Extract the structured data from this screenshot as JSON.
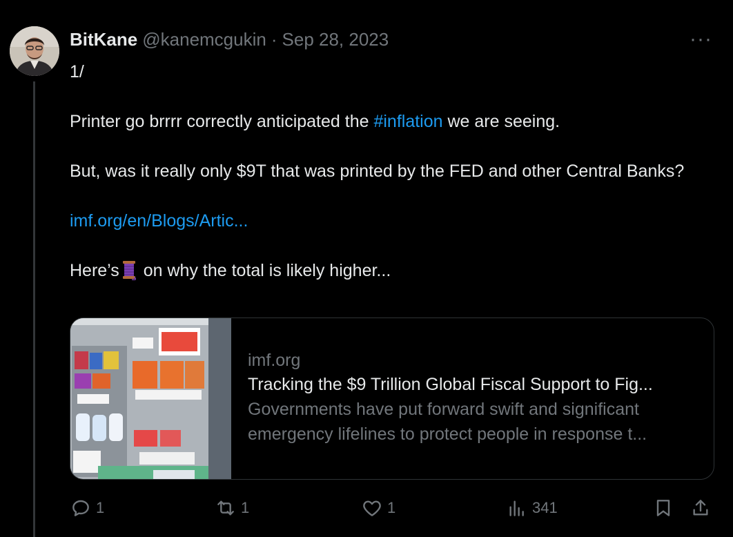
{
  "tweet": {
    "display_name": "BitKane",
    "handle": "@kanemcgukin",
    "separator": "·",
    "date": "Sep 28, 2023",
    "more_label": "···",
    "lines": {
      "l1": "1/",
      "l2_before": "Printer go brrrr correctly anticipated the ",
      "l2_hashtag": "#inflation",
      "l2_after": " we are seeing.",
      "l3": "But, was it really only $9T that was printed by the FED and other Central Banks?",
      "l4_link": "imf.org/en/Blogs/Artic...",
      "l5_before": "Here’s",
      "l5_after": " on why the total is likely higher..."
    },
    "card": {
      "domain": "imf.org",
      "title": "Tracking the $9 Trillion Global Fiscal Support to Fig...",
      "description": "Governments have put forward swift and significant emergency lifelines to protect people in response t..."
    },
    "actions": {
      "replies": "1",
      "reposts": "1",
      "likes": "1",
      "views": "341"
    },
    "colors": {
      "background": "#000000",
      "text": "#e7e9ea",
      "muted": "#71767b",
      "link": "#1d9bf0",
      "border": "#2f3336"
    }
  }
}
